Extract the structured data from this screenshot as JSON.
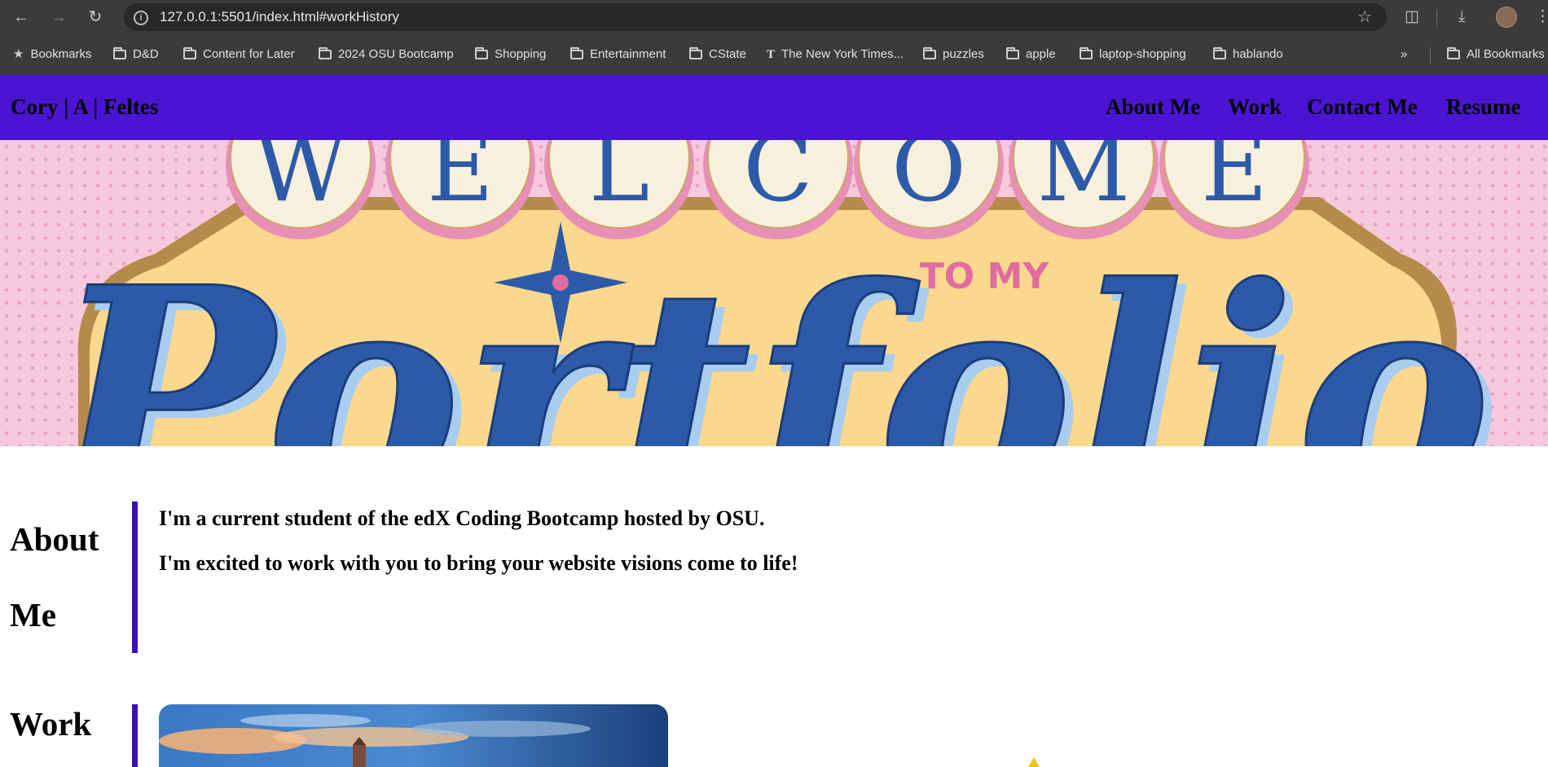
{
  "browser": {
    "url": "127.0.0.1:5501/index.html#workHistory",
    "bookmarks": [
      {
        "label": "Bookmarks",
        "icon": "star-icon"
      },
      {
        "label": "D&D",
        "icon": "folder-icon"
      },
      {
        "label": "Content for Later",
        "icon": "folder-icon"
      },
      {
        "label": "2024 OSU Bootcamp",
        "icon": "folder-icon"
      },
      {
        "label": "Shopping",
        "icon": "folder-icon"
      },
      {
        "label": "Entertainment",
        "icon": "folder-icon"
      },
      {
        "label": "CState",
        "icon": "folder-icon"
      },
      {
        "label": "The New York Times...",
        "icon": "nyt-icon"
      },
      {
        "label": "puzzles",
        "icon": "folder-icon"
      },
      {
        "label": "apple",
        "icon": "folder-icon"
      },
      {
        "label": "laptop-shopping",
        "icon": "folder-icon"
      },
      {
        "label": "hablando",
        "icon": "folder-icon"
      }
    ],
    "all_bookmarks": "All Bookmarks"
  },
  "header": {
    "title": "Cory | A | Feltes",
    "nav": [
      "About Me",
      "Work",
      "Contact Me",
      "Resume"
    ],
    "bg_color": "#4b14d2"
  },
  "hero": {
    "letters": [
      "W",
      "E",
      "L",
      "C",
      "O",
      "M",
      "E"
    ],
    "to_my": "TO MY",
    "script_word": "Portfolio"
  },
  "about": {
    "heading_line1": "About",
    "heading_line2": "Me",
    "paragraphs": [
      "I'm a current student of the edX Coding Bootcamp hosted by OSU.",
      "I'm excited to work with you to bring your website visions come to life!"
    ]
  },
  "work": {
    "heading": "Work"
  }
}
